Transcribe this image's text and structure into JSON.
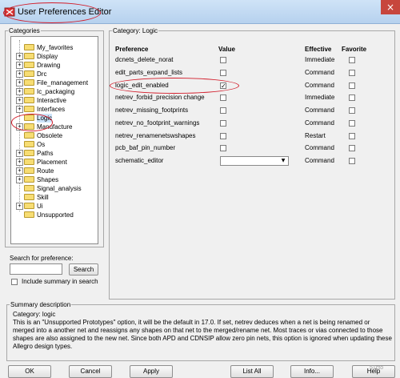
{
  "window": {
    "title": "User Preferences Editor",
    "close_glyph": "×"
  },
  "categories": {
    "legend": "Categories",
    "items": [
      {
        "label": "My_favorites",
        "expandable": false
      },
      {
        "label": "Display",
        "expandable": true
      },
      {
        "label": "Drawing",
        "expandable": true
      },
      {
        "label": "Drc",
        "expandable": true
      },
      {
        "label": "File_management",
        "expandable": true
      },
      {
        "label": "Ic_packaging",
        "expandable": true
      },
      {
        "label": "Interactive",
        "expandable": true
      },
      {
        "label": "Interfaces",
        "expandable": true
      },
      {
        "label": "Logic",
        "expandable": false,
        "selected": true
      },
      {
        "label": "Manufacture",
        "expandable": true
      },
      {
        "label": "Obsolete",
        "expandable": false
      },
      {
        "label": "Os",
        "expandable": false
      },
      {
        "label": "Paths",
        "expandable": true
      },
      {
        "label": "Placement",
        "expandable": true
      },
      {
        "label": "Route",
        "expandable": true
      },
      {
        "label": "Shapes",
        "expandable": true
      },
      {
        "label": "Signal_analysis",
        "expandable": false
      },
      {
        "label": "Skill",
        "expandable": false
      },
      {
        "label": "Ui",
        "expandable": true
      },
      {
        "label": "Unsupported",
        "expandable": false
      }
    ],
    "expander_glyph": "+"
  },
  "search": {
    "label": "Search for preference:",
    "value": "",
    "button": "Search",
    "include_summary_label": "Include summary in search",
    "include_summary_checked": false
  },
  "prefs": {
    "legend": "Category: Logic",
    "headers": {
      "preference": "Preference",
      "value": "Value",
      "effective": "Effective",
      "favorite": "Favorite"
    },
    "rows": [
      {
        "name": "dcnets_delete_norat",
        "value": false,
        "effective": "Immediate",
        "favorite": false
      },
      {
        "name": "edit_parts_expand_lists",
        "value": false,
        "effective": "Command",
        "favorite": false
      },
      {
        "name": "logic_edit_enabled",
        "value": true,
        "effective": "Command",
        "favorite": false
      },
      {
        "name": "netrev_forbid_precision change",
        "value": false,
        "effective": "Immediate",
        "favorite": false
      },
      {
        "name": "netrev_missing_footprints",
        "value": false,
        "effective": "Command",
        "favorite": false
      },
      {
        "name": "netrev_no_footprint_warnings",
        "value": false,
        "effective": "Command",
        "favorite": false
      },
      {
        "name": "netrev_renamenetswshapes",
        "value": false,
        "effective": "Restart",
        "favorite": false
      },
      {
        "name": "pcb_baf_pin_number",
        "value": false,
        "effective": "Command",
        "favorite": false
      },
      {
        "name": "schematic_editor",
        "value": "",
        "effective": "Command",
        "favorite": false,
        "type": "combo"
      }
    ],
    "check_glyph": "✓",
    "combo_arrow": "▼"
  },
  "summary": {
    "legend": "Summary description",
    "text": "Category: logic\nThis is an \"Unsupported Prototypes\" option, it will be the default in 17.0. If set, netrev deduces when a net is being renamed or merged into a another net and reassigns any shapes on that net to the merged/rename net. Most traces or vias connected to those shapes are also assigned to the new net. Since both APD and CDNSIP allow zero pin nets, this option is ignored when updating these Allegro design types."
  },
  "buttons": {
    "ok": "OK",
    "cancel": "Cancel",
    "apply": "Apply",
    "list_all": "List All",
    "info": "Info...",
    "help": "Help"
  },
  "watermark": "51cto",
  "colors": {
    "annotation": "#d21c2a",
    "selected": "#cde4fb",
    "folder": "#f7dd73"
  }
}
